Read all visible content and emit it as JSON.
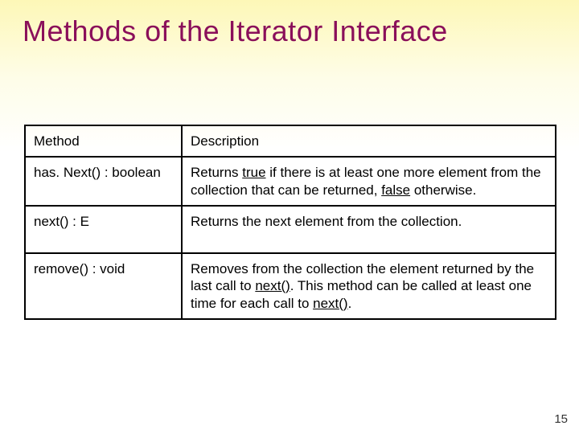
{
  "title": "Methods of the Iterator Interface",
  "headers": {
    "method": "Method",
    "description": "Description"
  },
  "rows": {
    "hasNext": {
      "method": "has. Next() : boolean",
      "desc_pre": "Returns ",
      "true_word": "true",
      "desc_mid": " if there is at least one more element from the collection that can be returned, ",
      "false_word": "false",
      "desc_post": " otherwise."
    },
    "next": {
      "method": "next() : E",
      "desc": "Returns the next element from the collection."
    },
    "remove": {
      "method": "remove() : void",
      "desc_a": "Removes from the collection the element returned by the last call to ",
      "call1": "next()",
      "desc_b": ". This method can be called at least one time for each call to ",
      "call2": "next()",
      "desc_c": "."
    }
  },
  "page_number": "15"
}
